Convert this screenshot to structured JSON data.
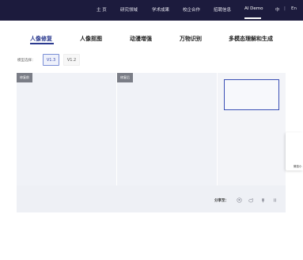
{
  "nav": {
    "items": [
      "主 页",
      "研究领域",
      "学术成果",
      "校企合作",
      "招聘信息",
      "AI Demo"
    ],
    "active": "AI Demo",
    "lang_zh": "中",
    "lang_sep": "|",
    "lang_en": "En"
  },
  "tabs": [
    "人像修复",
    "人像抠图",
    "动漫增强",
    "万物识别",
    "多模态理解和生成"
  ],
  "active_tab": "人像修复",
  "model": {
    "label": "模型选择：",
    "options": [
      "V1.3",
      "V1.2"
    ],
    "selected": "V1.3"
  },
  "panels": {
    "before_label": "修复前",
    "after_label": "修复后"
  },
  "share": {
    "label": "分享至：",
    "icons": [
      "qq-icon",
      "weibo-icon",
      "wechat-icon",
      "link-icon"
    ]
  },
  "side_widget": {
    "label": "微信小"
  },
  "colors": {
    "nav_bg": "#1c1b3d",
    "accent": "#2b3a8f",
    "selected_border": "#7b8fd6",
    "badge_bg": "#7a7d86",
    "panel_bg": "#f0f2f7"
  }
}
